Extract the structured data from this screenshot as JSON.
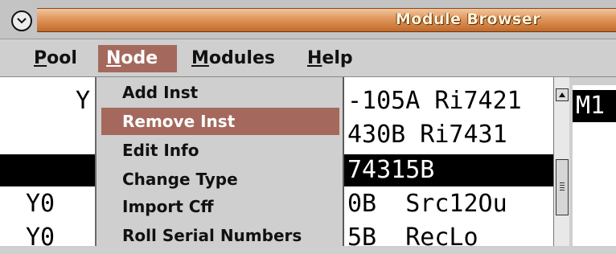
{
  "window": {
    "title": "Module Browser"
  },
  "menubar": {
    "items": [
      {
        "label": "Pool",
        "active": false
      },
      {
        "label": "Node",
        "active": true
      },
      {
        "label": "Modules",
        "active": false
      },
      {
        "label": "Help",
        "active": false
      }
    ]
  },
  "node_menu": {
    "items": [
      {
        "label": "Add Inst",
        "highlighted": false
      },
      {
        "label": "Remove Inst",
        "highlighted": true
      },
      {
        "label": "Edit Info",
        "highlighted": false
      },
      {
        "label": "Change Type",
        "highlighted": false
      },
      {
        "label": "Import Cff",
        "highlighted": false
      },
      {
        "label": "Roll Serial Numbers",
        "highlighted": false
      }
    ]
  },
  "module_list": {
    "rows": [
      {
        "left": "Y",
        "right": "-105A Ri7421",
        "selected": false
      },
      {
        "left": "",
        "right": "430B Ri7431",
        "selected": false
      },
      {
        "left": "",
        "right": "74315B",
        "selected": true
      },
      {
        "left": "Y0",
        "right": "0B  Src12Ou",
        "selected": false
      },
      {
        "left": "Y0",
        "right": "5B  RecLo",
        "selected": false
      }
    ]
  },
  "right_pane": {
    "selected_text": "M1"
  },
  "colors": {
    "title_stripe": "#e29a60",
    "menu_highlight": "#a4695c",
    "selection": "#000000"
  }
}
